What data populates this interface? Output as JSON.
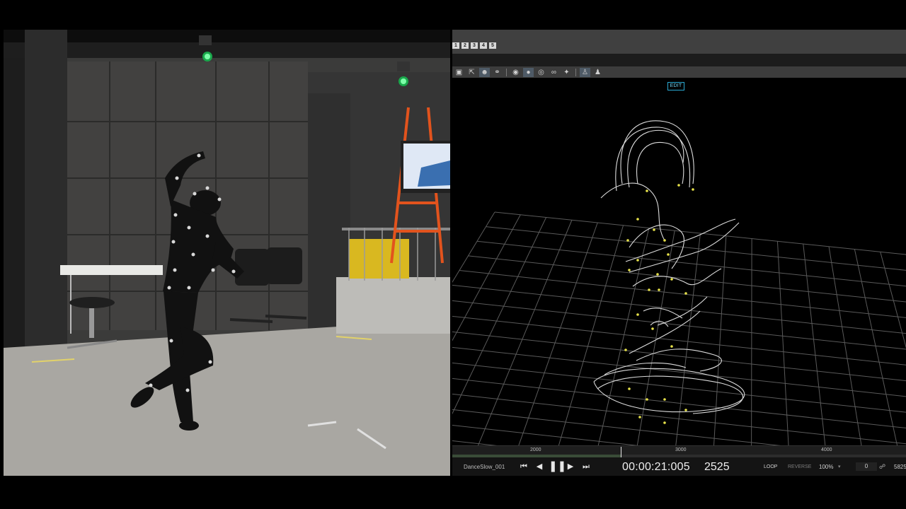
{
  "video": {
    "monitor_present": true,
    "status_lights": [
      "#2ee06a",
      "#2ee06a"
    ]
  },
  "layout_bar": {
    "buttons": [
      "1",
      "2",
      "3",
      "4",
      "5"
    ]
  },
  "toolbar": {
    "icons": [
      "camera-icon",
      "export-icon",
      "actor-icon",
      "lasso-icon",
      "eye-icon",
      "marker-icon",
      "marker-label-icon",
      "marker-link-icon",
      "marker-solve-icon",
      "skeleton-icon",
      "figure-icon"
    ]
  },
  "viewport": {
    "mode_badge": "EDIT",
    "accent": "#2aa9d3",
    "marker_color": "#e7e24a"
  },
  "timeline": {
    "ticks": [
      "2000",
      "3000",
      "4000"
    ],
    "current_frame": 2525
  },
  "transport": {
    "take_name": "DanceSlow_001",
    "timecode": "00:00:21:005",
    "frame": "2525",
    "loop_label": "LOOP",
    "reverse_label": "REVERSE",
    "speed": "100%",
    "offset": "0",
    "end_frame": "5825"
  }
}
